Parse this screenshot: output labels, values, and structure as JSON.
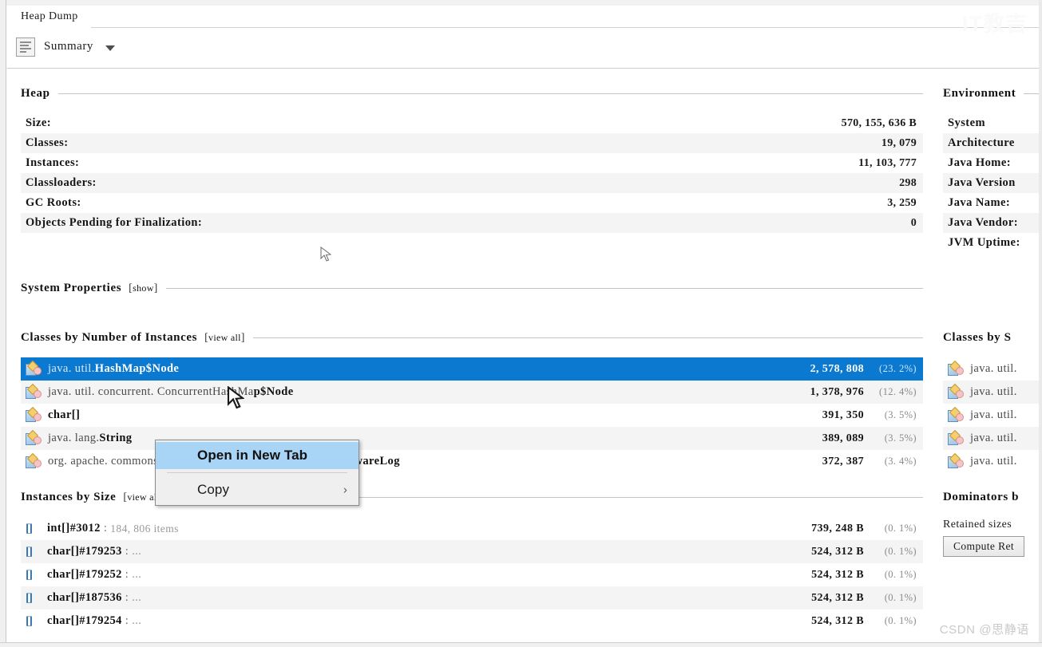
{
  "window": {
    "tab_label": "Heap Dump"
  },
  "toolbar": {
    "view_label": "Summary",
    "icon": "summary-page-icon",
    "caret": "chevron-down-icon"
  },
  "watermarks": {
    "top_right": "IT教吉",
    "bottom_right": "CSDN @思静语"
  },
  "heap": {
    "title": "Heap",
    "rows": [
      {
        "key": "Size:",
        "value": "570, 155, 636 B"
      },
      {
        "key": "Classes:",
        "value": "19, 079"
      },
      {
        "key": "Instances:",
        "value": "11, 103, 777"
      },
      {
        "key": "Classloaders:",
        "value": "298"
      },
      {
        "key": "GC Roots:",
        "value": "3, 259"
      },
      {
        "key": "Objects Pending for Finalization:",
        "value": "0"
      }
    ]
  },
  "system_properties": {
    "title": "System Properties",
    "link": "show",
    "bracket_open": "[",
    "bracket_close": "]"
  },
  "classes_by_instances": {
    "title": "Classes by Number of Instances",
    "link": "view all",
    "bracket_open": "[",
    "bracket_close": "]",
    "rows": [
      {
        "pkg": "java. util. ",
        "cls": "HashMap$Node",
        "count": "2, 578, 808",
        "pct": "(23. 2%)",
        "selected": true
      },
      {
        "pkg": "java. util. concurrent. ConcurrentHashMa",
        "cls": "p$Node",
        "count": "1, 378, 976",
        "pct": "(12. 4%)",
        "selected": false
      },
      {
        "pkg": "",
        "cls": "char[]",
        "count": "391, 350",
        "pct": "(3. 5%)",
        "selected": false
      },
      {
        "pkg": "java. lang. ",
        "cls": "String",
        "count": "389, 089",
        "pct": "(3. 5%)",
        "selected": false
      },
      {
        "pkg": "org. apache. commons. logging. ",
        "cls": "LogAdapter$Slf4jLocationAwareLog",
        "count": "372, 387",
        "pct": "(3. 4%)",
        "selected": false
      }
    ]
  },
  "instances_by_size": {
    "title": "Instances by Size",
    "link": "view all",
    "bracket_open": "[",
    "bracket_close": "]",
    "rows": [
      {
        "name": "int[]#3012",
        "meta": "184, 806 items",
        "size": "739, 248 B",
        "pct": "(0. 1%)"
      },
      {
        "name": "char[]#179253",
        "meta": "...",
        "size": "524, 312 B",
        "pct": "(0. 1%)"
      },
      {
        "name": "char[]#179252",
        "meta": "...",
        "size": "524, 312 B",
        "pct": "(0. 1%)"
      },
      {
        "name": "char[]#187536",
        "meta": "...",
        "size": "524, 312 B",
        "pct": "(0. 1%)"
      },
      {
        "name": "char[]#179254",
        "meta": "...",
        "size": "524, 312 B",
        "pct": "(0. 1%)"
      }
    ]
  },
  "environment": {
    "title": "Environment",
    "rows": [
      {
        "key": "System"
      },
      {
        "key": "Architecture"
      },
      {
        "key": "Java Home:"
      },
      {
        "key": "Java Version"
      },
      {
        "key": "Java Name:"
      },
      {
        "key": "Java Vendor:"
      },
      {
        "key": "JVM Uptime:"
      }
    ]
  },
  "classes_by_size": {
    "title": "Classes by S",
    "rows": [
      {
        "pkg": "java. util. "
      },
      {
        "pkg": "java. util. "
      },
      {
        "pkg": "java. util. "
      },
      {
        "pkg": "java. util. "
      },
      {
        "pkg": "java. util. "
      }
    ]
  },
  "dominators": {
    "title": "Dominators b",
    "note": "Retained sizes",
    "button_label": "Compute Ret"
  },
  "context_menu": {
    "items": [
      {
        "label": "Open in New Tab",
        "highlighted": true,
        "submenu": false
      },
      {
        "label": "Copy",
        "highlighted": false,
        "submenu": true,
        "submenu_icon": "chevron-right-icon"
      }
    ]
  },
  "colors": {
    "selection_blue": "#0b79d0",
    "menu_highlight": "#a8d5f5",
    "stripe_gray": "#f4f4f4",
    "rule_gray": "#c4c4c4"
  }
}
